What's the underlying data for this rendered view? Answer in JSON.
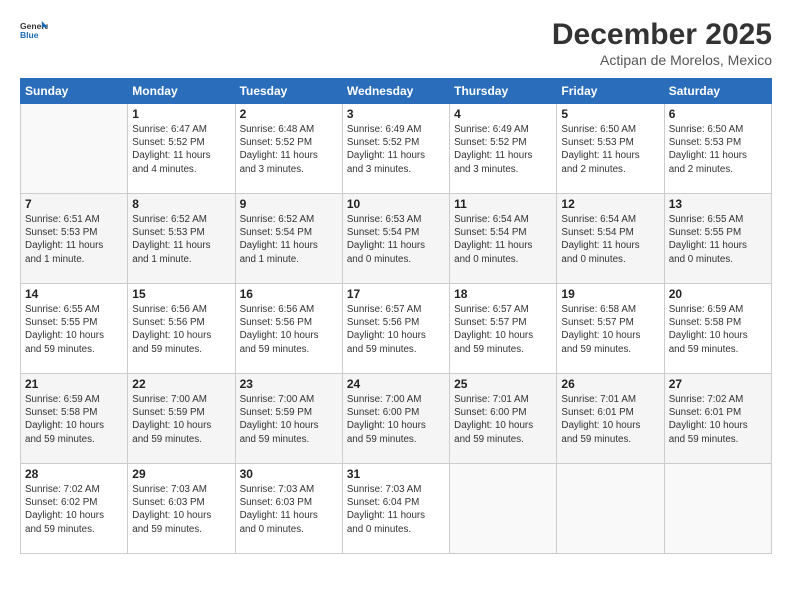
{
  "logo": {
    "general": "General",
    "blue": "Blue"
  },
  "title": "December 2025",
  "subtitle": "Actipan de Morelos, Mexico",
  "headers": [
    "Sunday",
    "Monday",
    "Tuesday",
    "Wednesday",
    "Thursday",
    "Friday",
    "Saturday"
  ],
  "weeks": [
    [
      {
        "day": "",
        "info": ""
      },
      {
        "day": "1",
        "info": "Sunrise: 6:47 AM\nSunset: 5:52 PM\nDaylight: 11 hours\nand 4 minutes."
      },
      {
        "day": "2",
        "info": "Sunrise: 6:48 AM\nSunset: 5:52 PM\nDaylight: 11 hours\nand 3 minutes."
      },
      {
        "day": "3",
        "info": "Sunrise: 6:49 AM\nSunset: 5:52 PM\nDaylight: 11 hours\nand 3 minutes."
      },
      {
        "day": "4",
        "info": "Sunrise: 6:49 AM\nSunset: 5:52 PM\nDaylight: 11 hours\nand 3 minutes."
      },
      {
        "day": "5",
        "info": "Sunrise: 6:50 AM\nSunset: 5:53 PM\nDaylight: 11 hours\nand 2 minutes."
      },
      {
        "day": "6",
        "info": "Sunrise: 6:50 AM\nSunset: 5:53 PM\nDaylight: 11 hours\nand 2 minutes."
      }
    ],
    [
      {
        "day": "7",
        "info": "Sunrise: 6:51 AM\nSunset: 5:53 PM\nDaylight: 11 hours\nand 1 minute."
      },
      {
        "day": "8",
        "info": "Sunrise: 6:52 AM\nSunset: 5:53 PM\nDaylight: 11 hours\nand 1 minute."
      },
      {
        "day": "9",
        "info": "Sunrise: 6:52 AM\nSunset: 5:54 PM\nDaylight: 11 hours\nand 1 minute."
      },
      {
        "day": "10",
        "info": "Sunrise: 6:53 AM\nSunset: 5:54 PM\nDaylight: 11 hours\nand 0 minutes."
      },
      {
        "day": "11",
        "info": "Sunrise: 6:54 AM\nSunset: 5:54 PM\nDaylight: 11 hours\nand 0 minutes."
      },
      {
        "day": "12",
        "info": "Sunrise: 6:54 AM\nSunset: 5:54 PM\nDaylight: 11 hours\nand 0 minutes."
      },
      {
        "day": "13",
        "info": "Sunrise: 6:55 AM\nSunset: 5:55 PM\nDaylight: 11 hours\nand 0 minutes."
      }
    ],
    [
      {
        "day": "14",
        "info": "Sunrise: 6:55 AM\nSunset: 5:55 PM\nDaylight: 10 hours\nand 59 minutes."
      },
      {
        "day": "15",
        "info": "Sunrise: 6:56 AM\nSunset: 5:56 PM\nDaylight: 10 hours\nand 59 minutes."
      },
      {
        "day": "16",
        "info": "Sunrise: 6:56 AM\nSunset: 5:56 PM\nDaylight: 10 hours\nand 59 minutes."
      },
      {
        "day": "17",
        "info": "Sunrise: 6:57 AM\nSunset: 5:56 PM\nDaylight: 10 hours\nand 59 minutes."
      },
      {
        "day": "18",
        "info": "Sunrise: 6:57 AM\nSunset: 5:57 PM\nDaylight: 10 hours\nand 59 minutes."
      },
      {
        "day": "19",
        "info": "Sunrise: 6:58 AM\nSunset: 5:57 PM\nDaylight: 10 hours\nand 59 minutes."
      },
      {
        "day": "20",
        "info": "Sunrise: 6:59 AM\nSunset: 5:58 PM\nDaylight: 10 hours\nand 59 minutes."
      }
    ],
    [
      {
        "day": "21",
        "info": "Sunrise: 6:59 AM\nSunset: 5:58 PM\nDaylight: 10 hours\nand 59 minutes."
      },
      {
        "day": "22",
        "info": "Sunrise: 7:00 AM\nSunset: 5:59 PM\nDaylight: 10 hours\nand 59 minutes."
      },
      {
        "day": "23",
        "info": "Sunrise: 7:00 AM\nSunset: 5:59 PM\nDaylight: 10 hours\nand 59 minutes."
      },
      {
        "day": "24",
        "info": "Sunrise: 7:00 AM\nSunset: 6:00 PM\nDaylight: 10 hours\nand 59 minutes."
      },
      {
        "day": "25",
        "info": "Sunrise: 7:01 AM\nSunset: 6:00 PM\nDaylight: 10 hours\nand 59 minutes."
      },
      {
        "day": "26",
        "info": "Sunrise: 7:01 AM\nSunset: 6:01 PM\nDaylight: 10 hours\nand 59 minutes."
      },
      {
        "day": "27",
        "info": "Sunrise: 7:02 AM\nSunset: 6:01 PM\nDaylight: 10 hours\nand 59 minutes."
      }
    ],
    [
      {
        "day": "28",
        "info": "Sunrise: 7:02 AM\nSunset: 6:02 PM\nDaylight: 10 hours\nand 59 minutes."
      },
      {
        "day": "29",
        "info": "Sunrise: 7:03 AM\nSunset: 6:03 PM\nDaylight: 10 hours\nand 59 minutes."
      },
      {
        "day": "30",
        "info": "Sunrise: 7:03 AM\nSunset: 6:03 PM\nDaylight: 11 hours\nand 0 minutes."
      },
      {
        "day": "31",
        "info": "Sunrise: 7:03 AM\nSunset: 6:04 PM\nDaylight: 11 hours\nand 0 minutes."
      },
      {
        "day": "",
        "info": ""
      },
      {
        "day": "",
        "info": ""
      },
      {
        "day": "",
        "info": ""
      }
    ]
  ]
}
